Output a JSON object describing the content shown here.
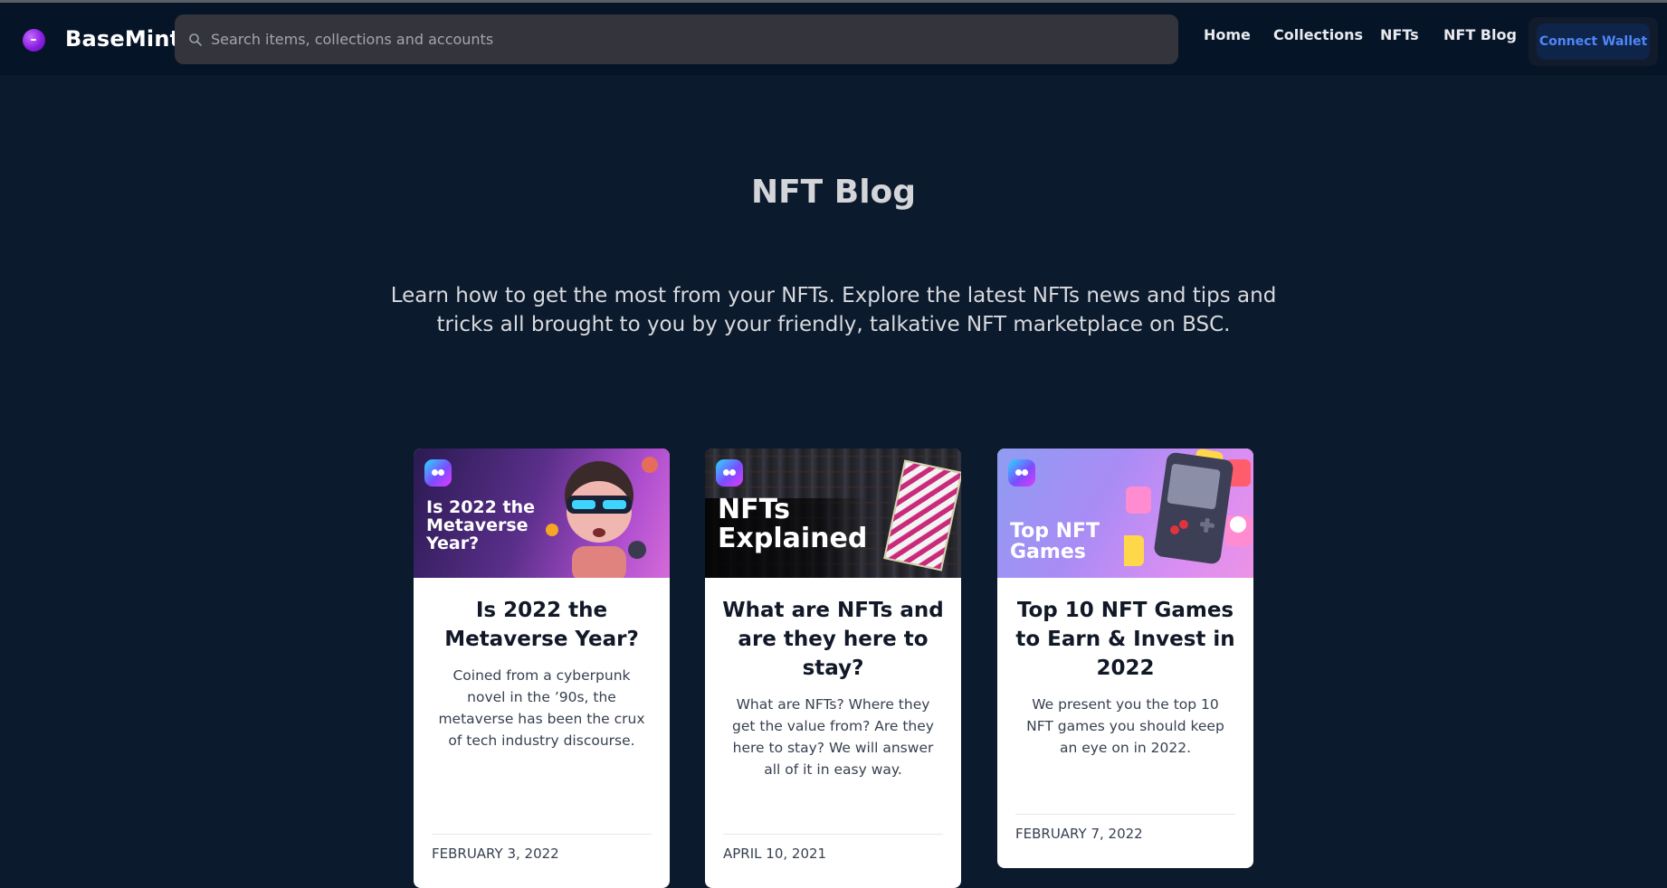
{
  "header": {
    "brand": "BaseMint",
    "search_placeholder": "Search items, collections and accounts",
    "nav": [
      "Home",
      "Collections",
      "NFTs",
      "NFT Blog"
    ],
    "wallet_button": "Connect Wallet"
  },
  "main": {
    "title": "NFT Blog",
    "intro": "Learn how to get the most from your NFTs. Explore the latest NFTs news and tips and tricks all brought to you by your friendly, talkative NFT marketplace on BSC."
  },
  "posts": [
    {
      "image_text": [
        "Is 2022 the",
        "Metaverse",
        "Year?"
      ],
      "title": "Is 2022 the Metaverse Year?",
      "excerpt": "Coined from a cyberpunk novel in the ’90s, the metaverse has been the crux of tech industry discourse.",
      "date": "FEBRUARY 3, 2022"
    },
    {
      "image_text": [
        "NFTs",
        "Explained"
      ],
      "title": "What are NFTs and are they here to stay?",
      "excerpt": "What are NFTs? Where they get the value from? Are they here to stay? We will answer all of it in easy way.",
      "date": "APRIL 10, 2021"
    },
    {
      "image_text": [
        "Top NFT",
        "Games"
      ],
      "title": "Top 10 NFT Games to Earn & Invest in 2022",
      "excerpt": "We present you the top 10 NFT games you should keep an eye on in 2022.",
      "date": "FEBRUARY 7, 2022"
    }
  ],
  "colors": {
    "background": "#0c1a2e",
    "navbar": "#061428",
    "accent": "#4f86f7",
    "card": "#ffffff"
  }
}
